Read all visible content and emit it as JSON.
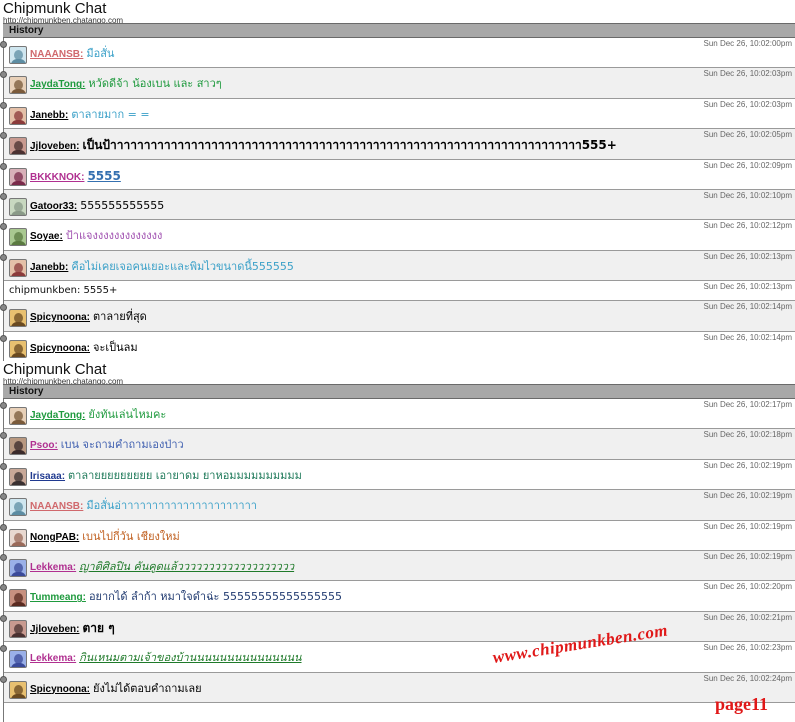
{
  "app": {
    "title": "Chipmunk Chat",
    "url": "http://chipmunkben.chatango.com",
    "history_label": "History"
  },
  "panels": [
    {
      "messages": [
        {
          "user": "NAAANSB:",
          "text": "มือสั่น",
          "time": "Sun Dec 26, 10:02:00pm",
          "name_color": "#d0686c",
          "text_color": "#3aa0c8",
          "avatar": [
            "#cfe6ef",
            "#5d8da3"
          ]
        },
        {
          "user": "JaydaTong:",
          "text": "หวัดดีจ้า น้องเบน และ สาวๆ",
          "time": "Sun Dec 26, 10:02:03pm",
          "name_color": "#1f9a3e",
          "text_color": "#1f9a3e",
          "avatar": [
            "#e8d0b8",
            "#7a5a3a"
          ]
        },
        {
          "user": "Janebb:",
          "text": "ตาลายมาก = =",
          "time": "Sun Dec 26, 10:02:03pm",
          "name_color": "#000000",
          "text_color": "#3aa0c8",
          "avatar": [
            "#e4c0a8",
            "#8b3a3a"
          ]
        },
        {
          "user": "Jjloveben:",
          "text": "เป็นป้าาาาาาาาาาาาาาาาาาาาาาาาาาาาาาาาาาาาาาาาาาาาาาาาาาาาาาาาาาาาาาาาาาาาาา555+",
          "time": "Sun Dec 26, 10:02:05pm",
          "name_color": "#000000",
          "text_color": "#000000",
          "avatar": [
            "#c89a90",
            "#4a3030"
          ]
        },
        {
          "user": "BKKKNOK:",
          "text": "5555",
          "time": "Sun Dec 26, 10:02:09pm",
          "name_color": "#b03090",
          "text_color": "#3570b0",
          "avatar": [
            "#d8b0b8",
            "#7a2a4a"
          ]
        },
        {
          "user": "Gatoor33:",
          "text": "555555555555",
          "time": "Sun Dec 26, 10:02:10pm",
          "name_color": "#000000",
          "text_color": "#000000",
          "avatar": [
            "#c8d8c0",
            "#8a9a88"
          ]
        },
        {
          "user": "Soyae:",
          "text": "ป้าแจงงงงงงงงงงงงง",
          "time": "Sun Dec 26, 10:02:12pm",
          "name_color": "#000000",
          "text_color": "#a050b0",
          "avatar": [
            "#a8c890",
            "#5a7a40"
          ]
        },
        {
          "user": "Janebb:",
          "text": "คือไม่เคยเจอคนเยอะและพิมไวขนาดนี้555555",
          "time": "Sun Dec 26, 10:02:13pm",
          "name_color": "#000000",
          "text_color": "#3aa0c8",
          "avatar": [
            "#e4c0a8",
            "#8b3a3a"
          ]
        },
        {
          "plain": true,
          "text": "chipmunkben: 5555+",
          "time": "Sun Dec 26, 10:02:13pm"
        },
        {
          "user": "Spicynoona:",
          "text": "ตาลายที่สุด",
          "time": "Sun Dec 26, 10:02:14pm",
          "name_color": "#000000",
          "text_color": "#000000",
          "avatar": [
            "#e8c070",
            "#6a4a20"
          ]
        },
        {
          "user": "Spicynoona:",
          "text": "จะเป็นลม",
          "time": "Sun Dec 26, 10:02:14pm",
          "name_color": "#000000",
          "text_color": "#000000",
          "avatar": [
            "#e8c070",
            "#6a4a20"
          ]
        }
      ]
    },
    {
      "messages": [
        {
          "user": "JaydaTong:",
          "text": "ยังทันเล่นไหมคะ",
          "time": "Sun Dec 26, 10:02:17pm",
          "name_color": "#1f9a3e",
          "text_color": "#1f9a3e",
          "avatar": [
            "#e8d0b8",
            "#7a5a3a"
          ]
        },
        {
          "user": "Psoo:",
          "text": "เบน จะถามคำถามเองป่าว",
          "time": "Sun Dec 26, 10:02:18pm",
          "name_color": "#b03090",
          "text_color": "#4060b0",
          "avatar": [
            "#b89880",
            "#3a2a2a"
          ]
        },
        {
          "user": "Irisaaa:",
          "text": "ตาลายยยยยยยยย เอายาดม ยาหอมมมมมมมมมม",
          "time": "Sun Dec 26, 10:02:19pm",
          "name_color": "#203a90",
          "text_color": "#1f7a5a",
          "avatar": [
            "#c8a898",
            "#3a3030"
          ]
        },
        {
          "user": "NAAANSB:",
          "text": "มือสั่นอ่าาาาาาาาาาาาาาาาาาาาาา",
          "time": "Sun Dec 26, 10:02:19pm",
          "name_color": "#d0686c",
          "text_color": "#3aa0c8",
          "avatar": [
            "#cfe6ef",
            "#5d8da3"
          ]
        },
        {
          "user": "NongPAB:",
          "text": "เบนไปกี่วัน เชียงใหม่",
          "time": "Sun Dec 26, 10:02:19pm",
          "name_color": "#000000",
          "text_color": "#c06020",
          "avatar": [
            "#e8d8d0",
            "#9a6a5a"
          ]
        },
        {
          "user": "Lekkema:",
          "text": "ญาติศิลปิน คันคูดแล้ววววววววววววววววววว",
          "time": "Sun Dec 26, 10:02:19pm",
          "name_color": "#b03090",
          "text_color": "#1f7a2a",
          "avatar": [
            "#9ab0e8",
            "#3a4a9a"
          ]
        },
        {
          "user": "Tummeang:",
          "text": "อยากได้ ลำก้า หมาใจดำฉ่ะ 55555555555555555",
          "time": "Sun Dec 26, 10:02:20pm",
          "name_color": "#1f9a3e",
          "text_color": "#203a70",
          "avatar": [
            "#c89080",
            "#5a2a20"
          ]
        },
        {
          "user": "Jjloveben:",
          "text": "ตาย ๆ",
          "time": "Sun Dec 26, 10:02:21pm",
          "name_color": "#000000",
          "text_color": "#000000",
          "avatar": [
            "#c89a90",
            "#4a3030"
          ]
        },
        {
          "user": "Lekkema:",
          "text": "กินเหนมตามเจ้าของบ้านนนนนนนนนนนนนนน",
          "time": "Sun Dec 26, 10:02:23pm",
          "name_color": "#b03090",
          "text_color": "#1f7a2a",
          "avatar": [
            "#9ab0e8",
            "#3a4a9a"
          ]
        },
        {
          "user": "Spicynoona:",
          "text": "ยังไม่ได้ตอบคำถามเลย",
          "time": "Sun Dec 26, 10:02:24pm",
          "name_color": "#000000",
          "text_color": "#000000",
          "avatar": [
            "#e8c070",
            "#6a4a20"
          ]
        }
      ]
    }
  ],
  "watermark": "www.chipmunkben.com",
  "page_label": "page11"
}
